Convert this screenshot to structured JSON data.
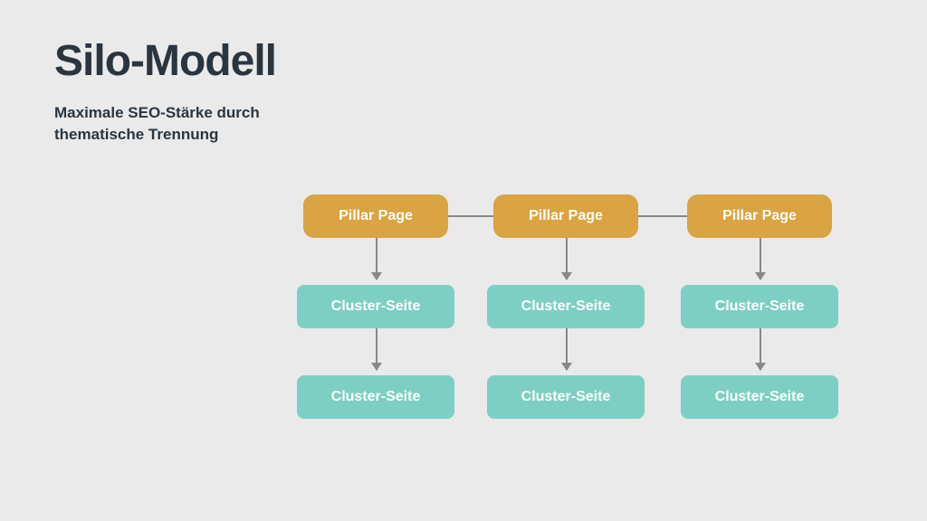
{
  "header": {
    "title": "Silo-Modell",
    "subtitle": "Maximale SEO-Stärke durch thematische Trennung"
  },
  "diagram": {
    "pillars": [
      {
        "label": "Pillar Page"
      },
      {
        "label": "Pillar Page"
      },
      {
        "label": "Pillar Page"
      }
    ],
    "clusters_row1": [
      {
        "label": "Cluster-Seite"
      },
      {
        "label": "Cluster-Seite"
      },
      {
        "label": "Cluster-Seite"
      }
    ],
    "clusters_row2": [
      {
        "label": "Cluster-Seite"
      },
      {
        "label": "Cluster-Seite"
      },
      {
        "label": "Cluster-Seite"
      }
    ]
  },
  "colors": {
    "pillar_bg": "#d9a441",
    "cluster_bg": "#7dcfc4",
    "text_dark": "#2a3540",
    "connector": "#888888",
    "page_bg": "#eaeaea"
  }
}
